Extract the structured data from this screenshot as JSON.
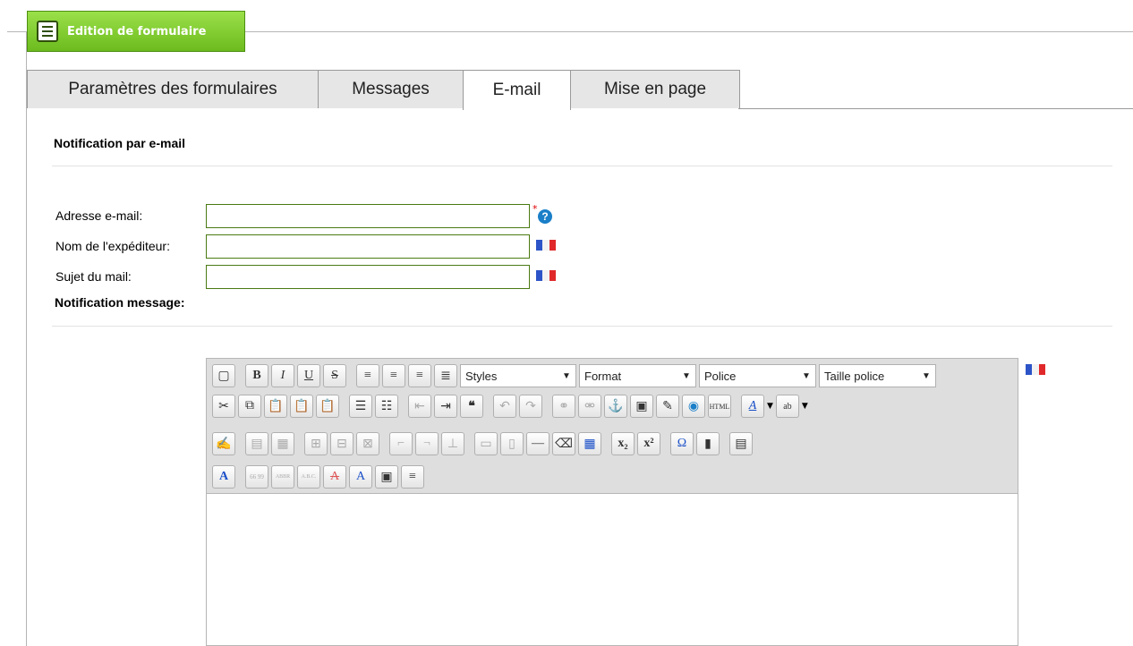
{
  "legend": {
    "title": "Edition de formulaire",
    "icon": "list-icon"
  },
  "tabs": [
    {
      "label": "Paramètres des formulaires",
      "active": false
    },
    {
      "label": "Messages",
      "active": false
    },
    {
      "label": "E-mail",
      "active": true
    },
    {
      "label": "Mise en page",
      "active": false
    }
  ],
  "section": {
    "title": "Notification par e-mail"
  },
  "fields": {
    "email": {
      "label": "Adresse e-mail:",
      "value": "",
      "required_mark": "*",
      "help": "?"
    },
    "sender": {
      "label": "Nom de l'expéditeur:",
      "value": ""
    },
    "subject": {
      "label": "Sujet du mail:",
      "value": ""
    }
  },
  "message": {
    "title": "Notification message:"
  },
  "editor": {
    "combos": {
      "styles": "Styles",
      "format": "Format",
      "font": "Police",
      "size": "Taille police"
    },
    "buttons": {
      "bold": "B",
      "italic": "I",
      "underline": "U",
      "strike": "S",
      "sub": "x₂",
      "sup": "x²",
      "omega": "Ω",
      "quote": "❝",
      "color": "A",
      "abbr1": "66 99",
      "abbr2": "ABBR",
      "abbr3": "A.B.C."
    },
    "content": ""
  },
  "colors": {
    "legend_bg": "#7acb2a",
    "field_border": "#4a7a12",
    "help_blue": "#1a7fc8",
    "required": "#d00000"
  }
}
